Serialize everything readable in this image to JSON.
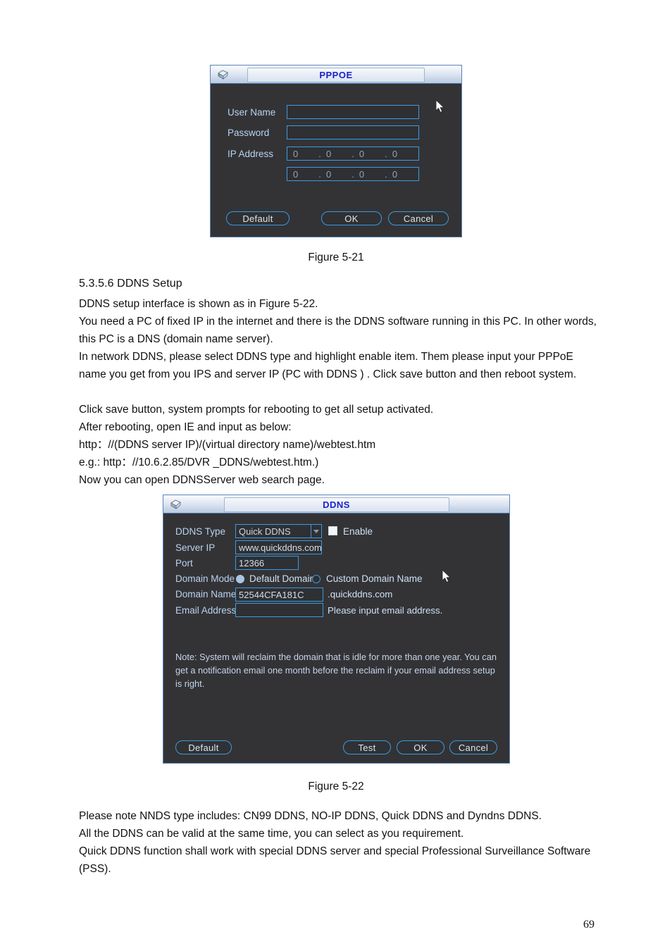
{
  "page": {
    "number": "69"
  },
  "figure_5_21": {
    "caption": "Figure 5-21",
    "dialog": {
      "title": "PPPOE",
      "title_icon": "network-globe-icon",
      "fields": {
        "user_name_label": "User Name",
        "user_name_value": "",
        "password_label": "Password",
        "password_value": "",
        "ip_address_label": "IP Address",
        "ip_address_1": [
          "0",
          "0",
          "0",
          "0"
        ],
        "ip_address_2": [
          "0",
          "0",
          "0",
          "0"
        ],
        "ip_separator": "."
      },
      "buttons": {
        "default": "Default",
        "ok": "OK",
        "cancel": "Cancel"
      },
      "cursor": "mouse-pointer"
    }
  },
  "section": {
    "heading": "5.3.5.6  DDNS Setup",
    "paragraphs": [
      "DDNS setup interface is shown as in Figure 5-22.",
      "You need a PC of fixed IP in the internet and there is the DDNS software running in this PC. In other words, this PC is a DNS (domain name server).",
      "In network DDNS, please select DDNS type and highlight enable item. Them please input your PPPoE name you get from you IPS and server IP (PC with DDNS ) . Click save button and then reboot system.",
      "Click save button, system prompts for rebooting to get all setup activated.",
      "After rebooting, open IE and input as below:",
      "http：//(DDNS server IP)/(virtual directory name)/webtest.htm",
      "e.g.: http：//10.6.2.85/DVR _DDNS/webtest.htm.)",
      "Now you can open DDNSServer web search page."
    ]
  },
  "figure_5_22": {
    "caption": "Figure 5-22",
    "dialog": {
      "title": "DDNS",
      "title_icon": "network-globe-icon",
      "fields": {
        "ddns_type_label": "DDNS Type",
        "ddns_type_value": "Quick DDNS",
        "enable_label": "Enable",
        "enable_checked": true,
        "server_ip_label": "Server IP",
        "server_ip_value": "www.quickddns.com",
        "port_label": "Port",
        "port_value": "12366",
        "domain_mode_label": "Domain Mode",
        "domain_mode_option_1": "Default Domain",
        "domain_mode_option_2": "Custom Domain Name",
        "domain_mode_selected": "Default Domain",
        "domain_name_label": "Domain Name",
        "domain_name_value": "52544CFA181C",
        "domain_name_suffix": ".quickddns.com",
        "email_address_label": "Email Address",
        "email_address_value": "",
        "email_hint": "Please input email address."
      },
      "note": "Note: System will reclaim the domain that is idle for more than one year. You can get a notification email one month before the reclaim if your email address setup is right.",
      "buttons": {
        "default": "Default",
        "test": "Test",
        "ok": "OK",
        "cancel": "Cancel"
      },
      "cursor": "mouse-pointer"
    }
  },
  "footer_paragraphs": [
    "Please note NNDS type includes: CN99 DDNS, NO-IP DDNS, Quick DDNS and Dyndns DDNS.",
    "All the DDNS can be valid at the same time, you can select as you requirement.",
    "Quick DDNS function shall work with special DDNS server and special Professional Surveillance Software (PSS)."
  ],
  "colors": {
    "dialog_bg": "#333336",
    "accent_blue": "#3c9ae0",
    "label_blue": "#b9d3ee",
    "title_text": "#1a22cc"
  }
}
